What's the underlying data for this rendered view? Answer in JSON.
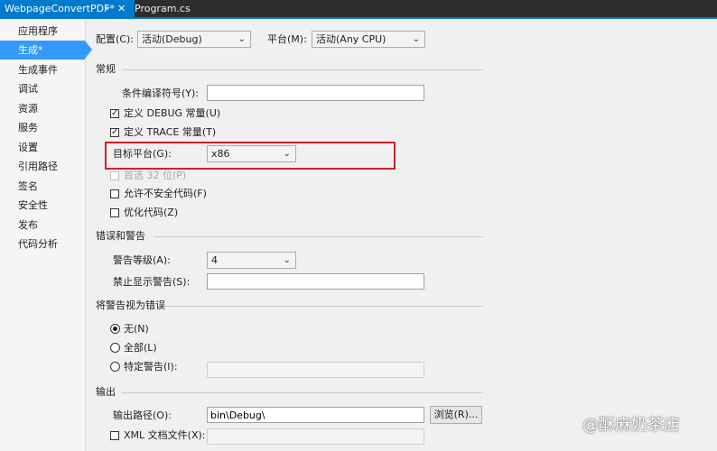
{
  "tabs": {
    "active": "WebpageConvertPDF*",
    "pin": "⌖",
    "close": "✕",
    "other": "Program.cs"
  },
  "sidebar": {
    "items": [
      "应用程序",
      "生成*",
      "生成事件",
      "调试",
      "资源",
      "服务",
      "设置",
      "引用路径",
      "签名",
      "安全性",
      "发布",
      "代码分析"
    ],
    "selected_index": 1
  },
  "config": {
    "config_label": "配置(C):",
    "config_value": "活动(Debug)",
    "platform_label": "平台(M):",
    "platform_value": "活动(Any CPU)"
  },
  "general": {
    "heading": "常规",
    "symbols_label": "条件编译符号(Y):",
    "symbols_value": "",
    "debug_label": "定义 DEBUG 常量(U)",
    "debug_checked": true,
    "trace_label": "定义 TRACE 常量(T)",
    "trace_checked": true,
    "target_label": "目标平台(G):",
    "target_value": "x86",
    "prefer32_label": "首选 32 位(P)",
    "unsafe_label": "允许不安全代码(F)",
    "optimize_label": "优化代码(Z)"
  },
  "errors": {
    "heading": "错误和警告",
    "level_label": "警告等级(A):",
    "level_value": "4",
    "suppress_label": "禁止显示警告(S):",
    "suppress_value": ""
  },
  "treat": {
    "heading": "将警告视为错误",
    "none_label": "无(N)",
    "all_label": "全部(L)",
    "specific_label": "特定警告(I):",
    "selected": "none"
  },
  "output": {
    "heading": "输出",
    "path_label": "输出路径(O):",
    "path_value": "bin\\Debug\\",
    "browse_label": "浏览(R)...",
    "xml_label": "XML 文档文件(X):"
  },
  "watermark": "@酥麻奶茶店",
  "icons": {
    "chevron": "⌄",
    "check": "✓"
  },
  "colors": {
    "accent": "#007acc",
    "selected_nav": "#3399ff",
    "highlight_border": "#d0202a"
  }
}
